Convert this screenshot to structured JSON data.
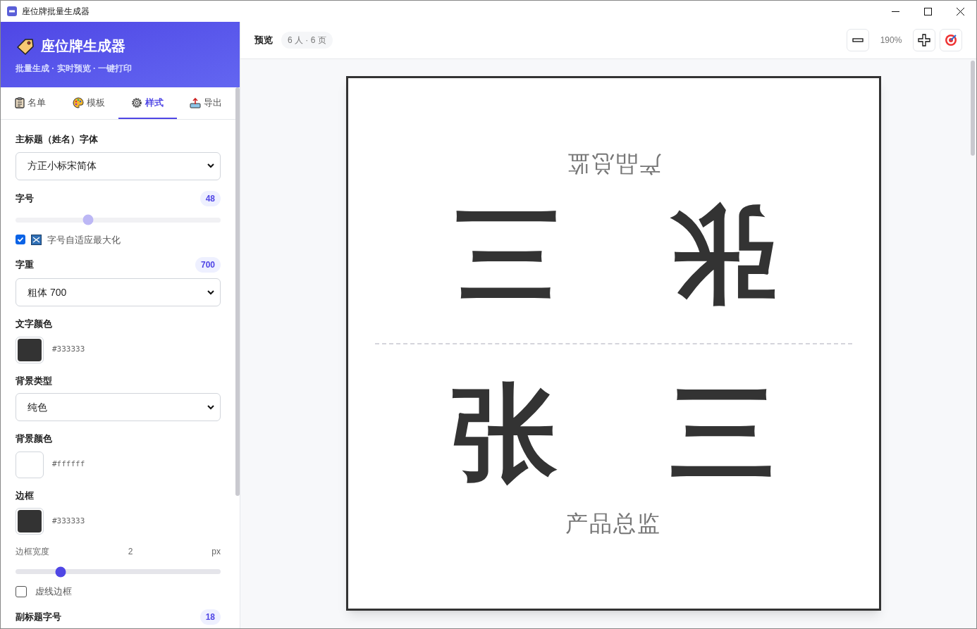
{
  "window": {
    "title": "座位牌批量生成器"
  },
  "header": {
    "title": "座位牌生成器",
    "subtitle": "批量生成 · 实时预览 · 一键打印"
  },
  "tabs": [
    {
      "label": "名单",
      "selected": false
    },
    {
      "label": "模板",
      "selected": false
    },
    {
      "label": "样式",
      "selected": true
    },
    {
      "label": "导出",
      "selected": false
    }
  ],
  "fields": [
    {
      "kind": "select",
      "label": "主标题（姓名）字体",
      "value": "方正小标宋简体"
    },
    {
      "kind": "slider",
      "label": "字号",
      "badge": "48",
      "level": 0.355,
      "disabled": true
    },
    {
      "kind": "iconcheckbox",
      "label": "字号自适应最大化",
      "checked": true
    },
    {
      "kind": "select",
      "label": "字重",
      "badge": "700",
      "value": "粗体 700"
    },
    {
      "kind": "color",
      "label": "文字颜色",
      "value": "#333333"
    },
    {
      "kind": "select",
      "label": "背景类型",
      "value": "纯色"
    },
    {
      "kind": "color",
      "label": "背景颜色",
      "value": "#ffffff"
    },
    {
      "kind": "color",
      "label": "边框",
      "value": "#333333"
    },
    {
      "kind": "range",
      "label": "边框宽度",
      "reading": "2",
      "unit": "px",
      "level": 0.22
    },
    {
      "kind": "checkbox",
      "label": "虚线边框",
      "checked": false
    },
    {
      "kind": "heading",
      "label": "副标题字号",
      "badge": "18"
    }
  ],
  "preview": {
    "title": "预览",
    "count": "6 人 · 6 页",
    "zoom": "190%"
  },
  "card": {
    "top": {
      "name": [
        "张",
        "三"
      ],
      "subtitle": "产品总监"
    },
    "bottom": {
      "name": [
        "张",
        "三"
      ],
      "subtitle": "产品总监"
    }
  }
}
